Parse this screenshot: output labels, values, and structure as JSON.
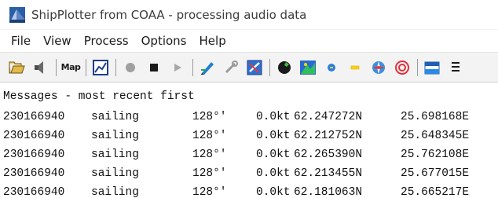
{
  "window": {
    "title": "ShipPlotter from COAA - processing audio data"
  },
  "menu": {
    "items": [
      "File",
      "View",
      "Process",
      "Options",
      "Help"
    ]
  },
  "toolbar": {
    "map_label": "Map",
    "buttons": [
      "open-folder-icon",
      "sound-icon",
      "map-button",
      "chart-icon",
      "record-icon",
      "stop-icon",
      "play-icon",
      "draw-icon",
      "tools-icon",
      "zoom-icon",
      "globe-icon",
      "ships-icon",
      "plus-icon",
      "minus-icon",
      "compass-icon",
      "target-icon",
      "window-icon",
      "list-icon"
    ]
  },
  "messages": {
    "header": "Messages - most recent first",
    "rows": [
      {
        "id": "230166940",
        "status": "sailing",
        "course": "128°'",
        "speed": "0.0kt",
        "lat": "62.247272N",
        "lon": "25.698168E"
      },
      {
        "id": "230166940",
        "status": "sailing",
        "course": "128°'",
        "speed": "0.0kt",
        "lat": "62.212752N",
        "lon": "25.648345E"
      },
      {
        "id": "230166940",
        "status": "sailing",
        "course": "128°'",
        "speed": "0.0kt",
        "lat": "62.265390N",
        "lon": "25.762108E"
      },
      {
        "id": "230166940",
        "status": "sailing",
        "course": "128°'",
        "speed": "0.0kt",
        "lat": "62.213455N",
        "lon": "25.677015E"
      },
      {
        "id": "230166940",
        "status": "sailing",
        "course": "128°'",
        "speed": "0.0kt",
        "lat": "62.181063N",
        "lon": "25.665217E"
      }
    ]
  }
}
